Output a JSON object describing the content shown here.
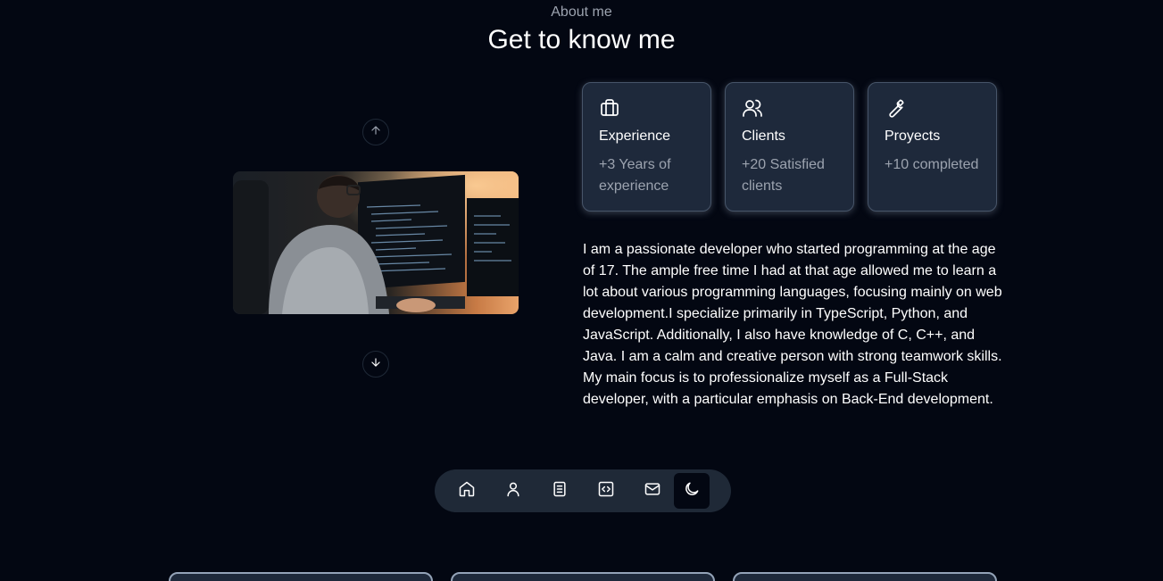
{
  "header": {
    "eyebrow": "About me",
    "title": "Get to know me"
  },
  "carousel": {
    "up_icon": "arrow-up-icon",
    "down_icon": "arrow-down-icon",
    "photo": "developer-coding-photo"
  },
  "stats": [
    {
      "icon": "briefcase-icon",
      "title": "Experience",
      "subtitle": "+3 Years of experience"
    },
    {
      "icon": "users-icon",
      "title": "Clients",
      "subtitle": "+20 Satisfied clients"
    },
    {
      "icon": "wrench-icon",
      "title": "Proyects",
      "subtitle": "+10 completed"
    }
  ],
  "about": {
    "text": "I am a passionate developer who started programming at the age of 17. The ample free time I had at that age allowed me to learn a lot about various programming languages, focusing mainly on web development.I specialize primarily in TypeScript, Python, and JavaScript. Additionally, I also have knowledge of C, C++, and Java. I am a calm and creative person with strong teamwork skills. My main focus is to professionalize myself as a Full-Stack developer, with a particular emphasis on Back-End development."
  },
  "dock": {
    "items": [
      "home-icon",
      "user-icon",
      "book-icon",
      "code-icon",
      "mail-icon",
      "moon-icon"
    ],
    "active": "moon-icon"
  },
  "colors": {
    "background": "#030712",
    "card": "#1e293b",
    "muted_text": "#9ca3af",
    "dock": "#1f2937"
  }
}
